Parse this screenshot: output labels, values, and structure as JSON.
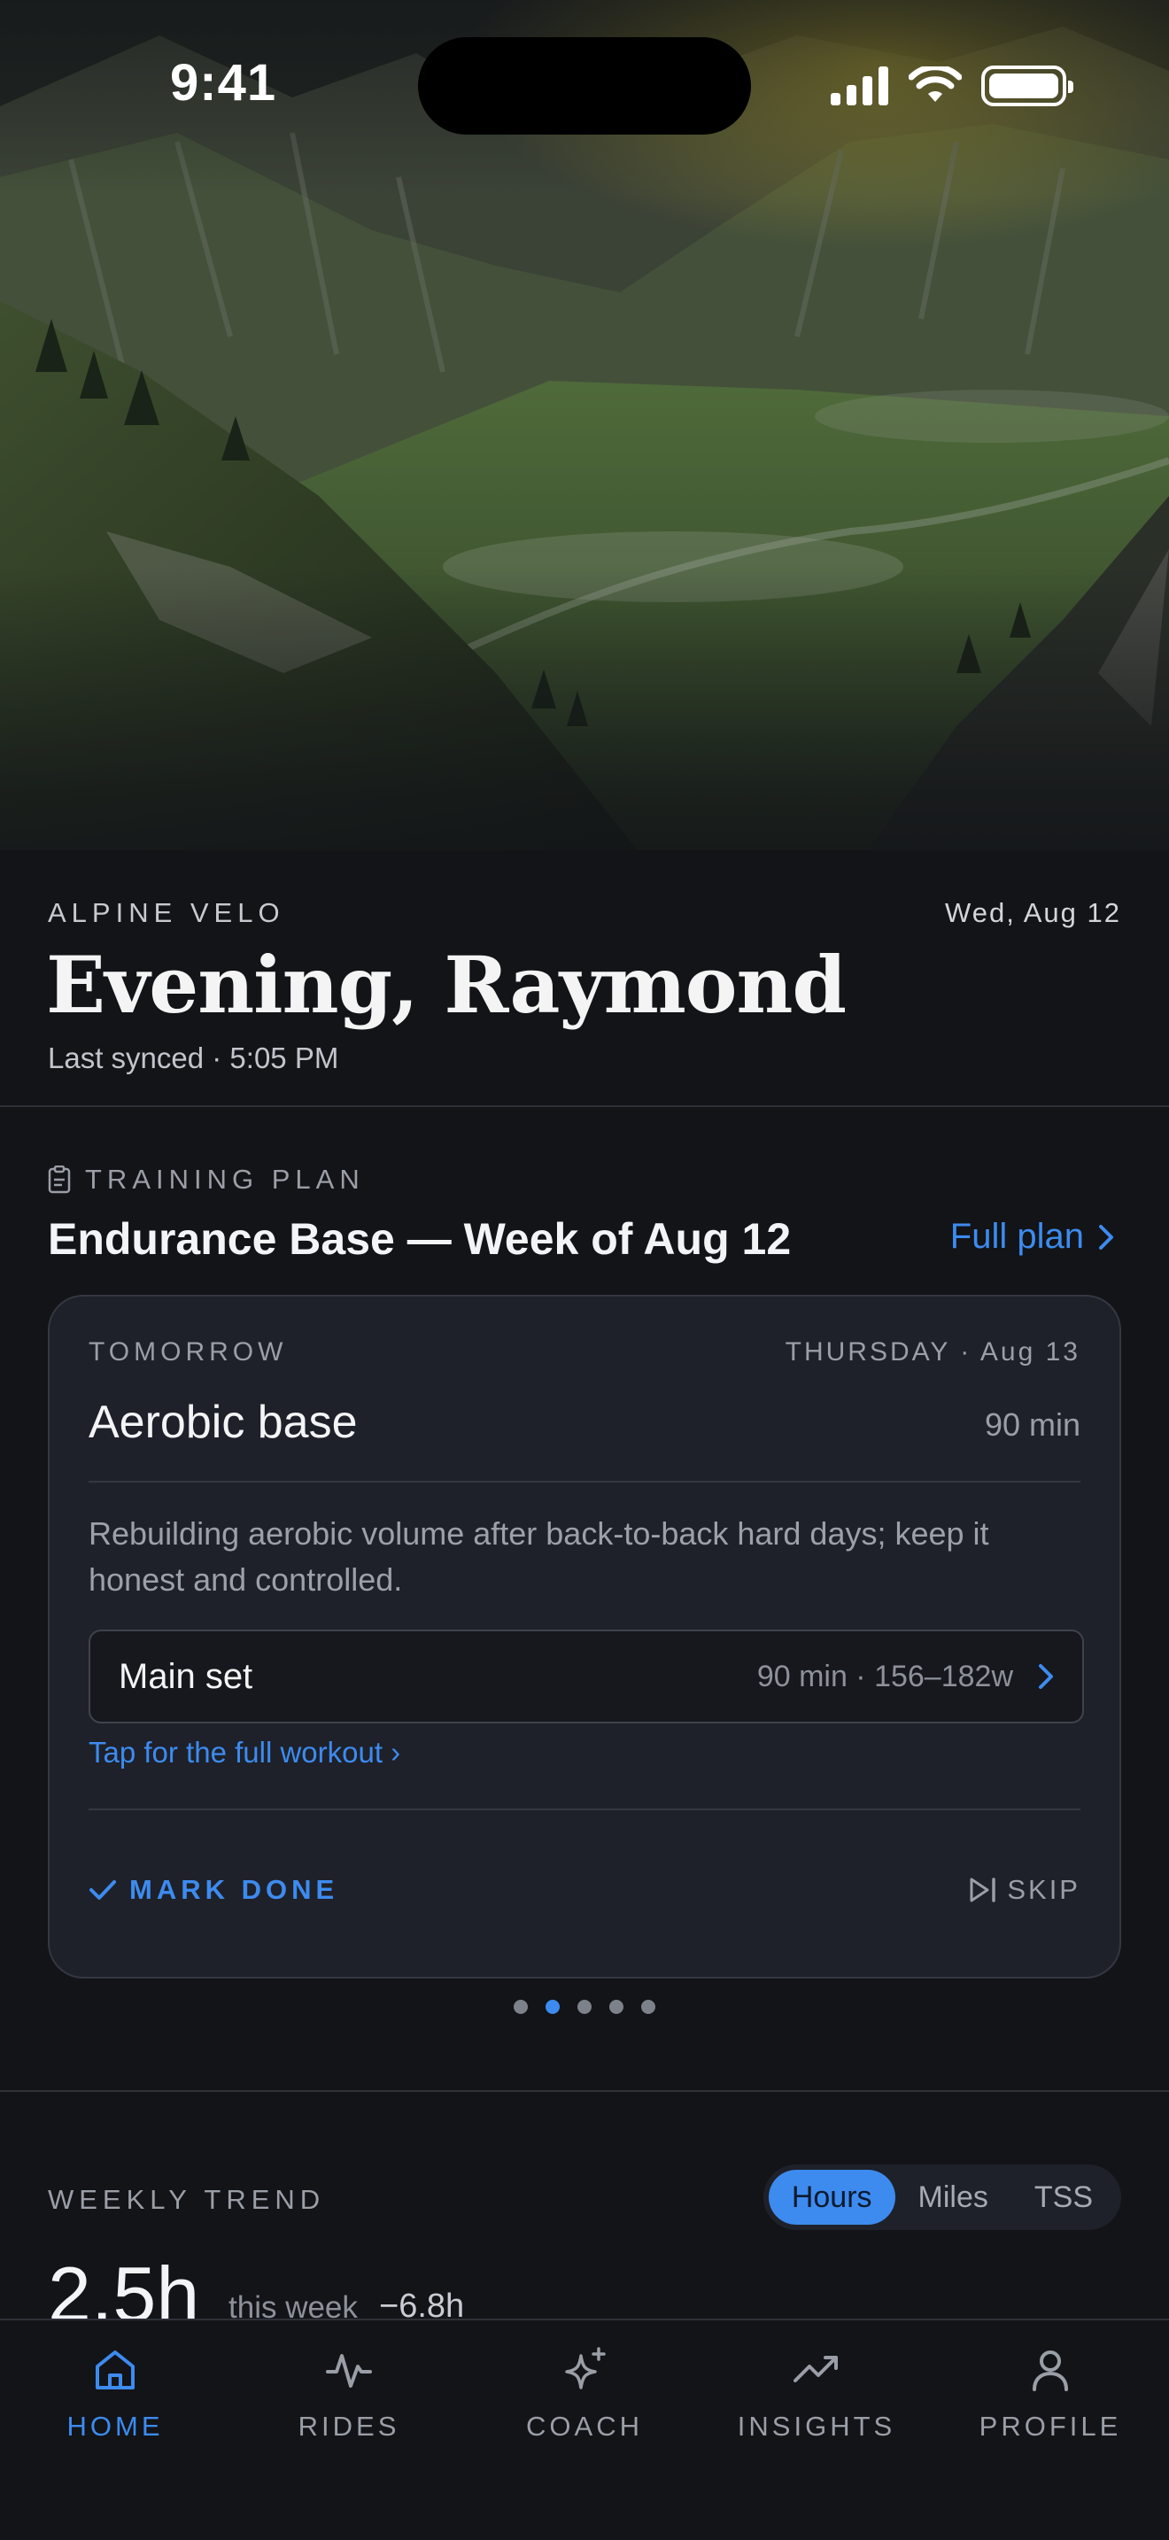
{
  "status_bar": {
    "time": "9:41"
  },
  "header": {
    "brand": "ALPINE VELO",
    "date": "Wed, Aug 12",
    "greeting": "Evening, Raymond",
    "last_synced": "Last synced · 5:05 PM"
  },
  "training_plan": {
    "section_label": "TRAINING PLAN",
    "title": "Endurance Base — Week of Aug 12",
    "full_plan_link": "Full plan",
    "card": {
      "when": "TOMORROW",
      "day": "THURSDAY · Aug 13",
      "workout_name": "Aerobic base",
      "duration": "90 min",
      "description": "Rebuilding aerobic volume after back-to-back hard days; keep it honest and controlled.",
      "main_set_label": "Main set",
      "main_set_meta": "90 min · 156–182w",
      "full_workout_link": "Tap for the full workout ›",
      "mark_done": "MARK DONE",
      "skip": "SKIP"
    },
    "pager": {
      "count": 5,
      "active_index": 1
    }
  },
  "weekly_trend": {
    "section_label": "WEEKLY TREND",
    "segments": [
      "Hours",
      "Miles",
      "TSS"
    ],
    "selected_segment": "Hours",
    "value": "2.5h",
    "value_caption": "this week",
    "delta": "−6.8h"
  },
  "tab_bar": {
    "tabs": [
      {
        "label": "HOME",
        "icon": "home-icon",
        "active": true
      },
      {
        "label": "RIDES",
        "icon": "activity-pulse-icon",
        "active": false
      },
      {
        "label": "COACH",
        "icon": "sparkles-icon",
        "active": false
      },
      {
        "label": "INSIGHTS",
        "icon": "trending-up-icon",
        "active": false
      },
      {
        "label": "PROFILE",
        "icon": "user-icon",
        "active": false
      }
    ]
  },
  "colors": {
    "background": "#121418",
    "card": "#1e212a",
    "accent": "#3d8bef",
    "muted_text": "#9a9ea6"
  }
}
